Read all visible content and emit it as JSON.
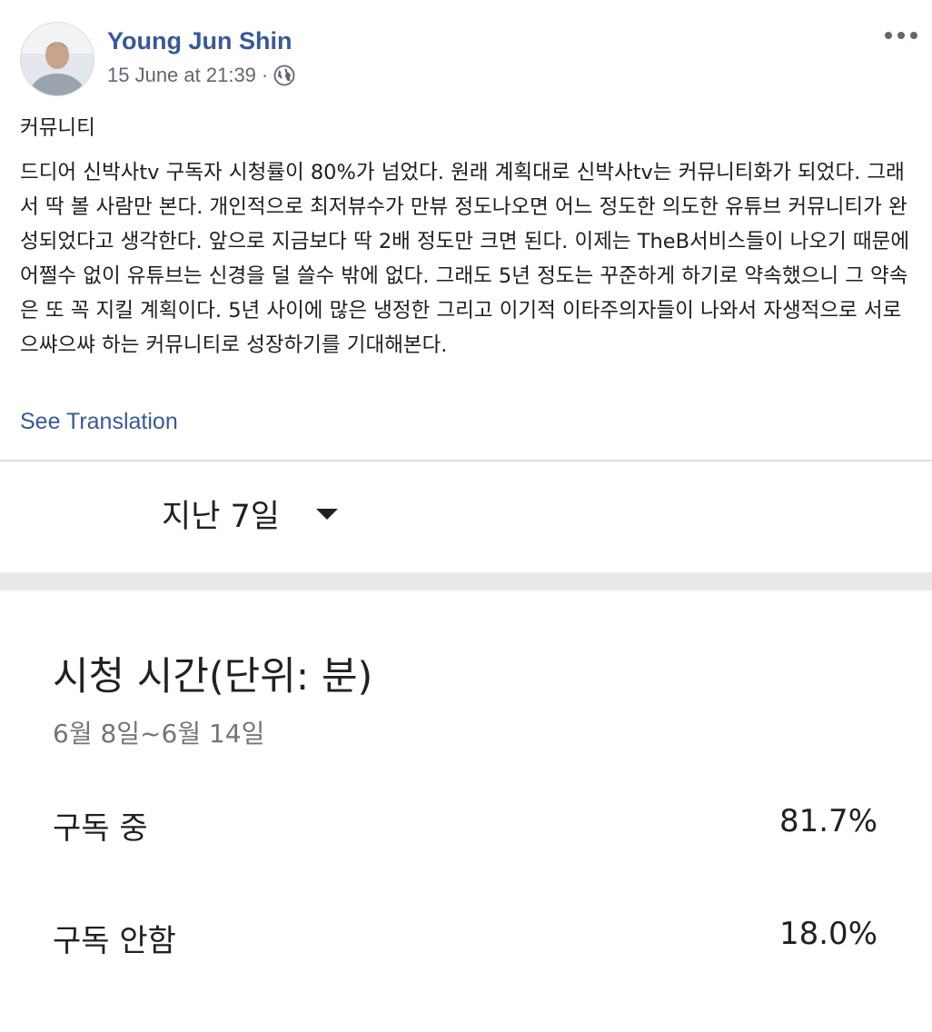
{
  "post": {
    "author": "Young Jun Shin",
    "timestamp": "15 June at 21:39",
    "separator": "·",
    "privacy_icon": "globe-icon",
    "more_icon": "more-options-icon",
    "title": "커뮤니티",
    "body": "드디어 신박사tv 구독자 시청률이 80%가 넘었다. 원래 계획대로 신박사tv는 커뮤니티화가 되었다. 그래서 딱 볼 사람만 본다. 개인적으로 최저뷰수가 만뷰 정도나오면 어느 정도한 의도한 유튜브 커뮤니티가 완성되었다고 생각한다. 앞으로 지금보다 딱 2배 정도만 크면 된다. 이제는 TheB서비스들이 나오기 때문에 어쩔수 없이 유튜브는 신경을 덜 쓸수 밖에 없다. 그래도 5년 정도는 꾸준하게 하기로 약속했으니 그 약속은 또 꼭 지킬 계획이다. 5년 사이에 많은 냉정한 그리고 이기적 이타주의자들이 나와서 자생적으로 서로 으쌰으쌰 하는 커뮤니티로 성장하기를 기대해본다.",
    "see_translation": "See Translation"
  },
  "analytics": {
    "period_label": "지난 7일",
    "title": "시청 시간(단위: 분)",
    "date_range": "6월 8일~6월 14일",
    "rows": [
      {
        "label": "구독 중",
        "value": "81.7%"
      },
      {
        "label": "구독 안함",
        "value": "18.0%"
      }
    ]
  },
  "colors": {
    "link": "#385898",
    "meta": "#616770",
    "band": "#e9e9e9"
  }
}
